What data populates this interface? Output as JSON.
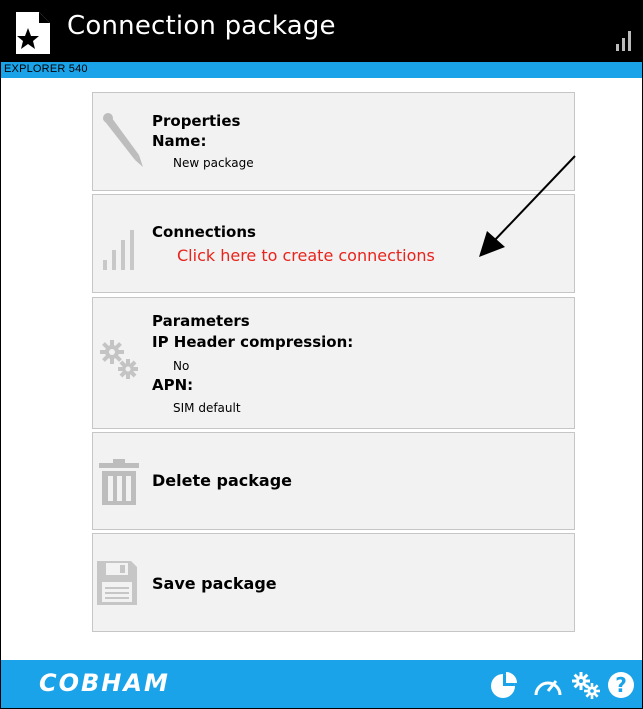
{
  "header": {
    "title": "Connection package",
    "device": "EXPLORER 540"
  },
  "cards": {
    "properties": {
      "heading": "Properties",
      "name_label": "Name:",
      "name_value": "New package"
    },
    "connections": {
      "heading": "Connections",
      "link": "Click here to create connections"
    },
    "parameters": {
      "heading": "Parameters",
      "ip_label": "IP Header compression:",
      "ip_value": "No",
      "apn_label": "APN:",
      "apn_value": "SIM default"
    },
    "delete": {
      "label": "Delete package"
    },
    "save": {
      "label": "Save package"
    }
  },
  "footer": {
    "brand": "COBHAM"
  },
  "colors": {
    "accent": "#1aa3e8",
    "link": "#e8231b",
    "card_bg": "#f2f2f2",
    "icon_gray": "#bdbdbd"
  },
  "icons": [
    "document-star-icon",
    "signal-icon",
    "pen-icon",
    "signal-bars-icon",
    "gears-icon",
    "trash-icon",
    "floppy-icon",
    "pie-chart-icon",
    "gauge-icon",
    "settings-icon",
    "help-icon"
  ]
}
